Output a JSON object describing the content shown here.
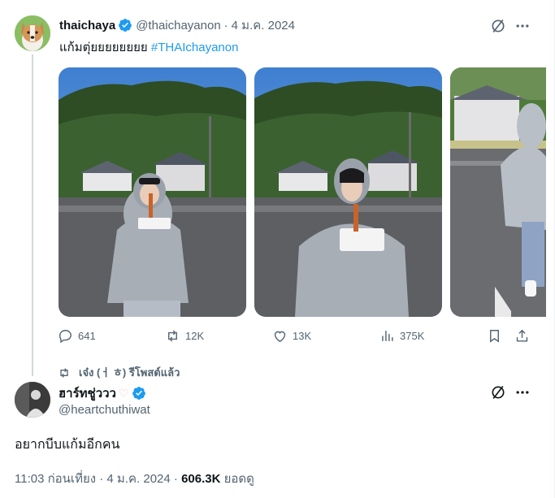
{
  "quoted_tweet": {
    "display_name": "thaichaya",
    "handle": "@thaichayanon",
    "date": "4 ม.ค. 2024",
    "text_plain": "แก้มตุ่ยยยยยยยย",
    "hashtag": "#THAIchayanon",
    "media_count": 3,
    "stats": {
      "replies": "641",
      "reposts": "12K",
      "likes": "13K",
      "views": "375K"
    }
  },
  "repost_line": {
    "text": "เจ๋ง (ㅓ ㅎ) รีโพสต์แล้ว"
  },
  "main_tweet": {
    "display_name": "ฮาร์ทชู่ววว",
    "handle": "@heartchuthiwat",
    "text": "อยากบีบแก้มอีกคน",
    "time": "11:03 ก่อนเที่ยง",
    "date": "4 ม.ค. 2024",
    "views_count": "606.3K",
    "views_label": "ยอดดู"
  },
  "colors": {
    "accent": "#1d9bf0",
    "muted": "#536471",
    "text": "#0f1419",
    "thread_line": "#cfd9de"
  },
  "icons": [
    "verified-badge-icon",
    "grok-icon",
    "more-icon",
    "reply-icon",
    "repost-icon",
    "like-icon",
    "views-icon",
    "bookmark-icon",
    "share-icon"
  ]
}
